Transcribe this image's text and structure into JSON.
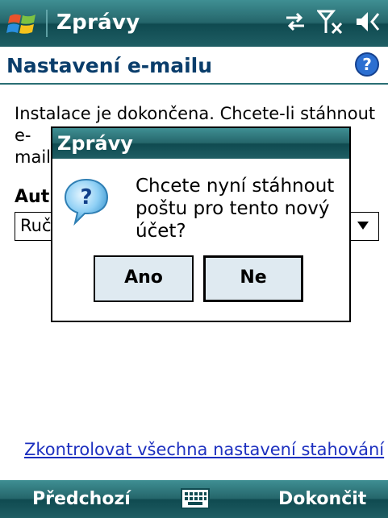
{
  "taskbar": {
    "title": "Zprávy",
    "icons": [
      "windows-start-icon",
      "connectivity-icon",
      "signal-off-icon",
      "volume-off-icon"
    ]
  },
  "header": {
    "title": "Nastavení e-mailu",
    "help_icon": "help-icon"
  },
  "content": {
    "body_line1": "Instalace je dokončena. Chcete-li stáhnout e-",
    "body_line2": "mail",
    "section_label": "Aut",
    "dropdown_value": "Ruč",
    "link_text": "Zkontrolovat všechna nastavení stahování"
  },
  "dialog": {
    "title": "Zprávy",
    "icon": "question-icon",
    "message": "Chcete nyní stáhnout poštu pro tento nový účet?",
    "yes_label": "Ano",
    "no_label": "Ne"
  },
  "softkeys": {
    "left": "Předchozí",
    "right": "Dokončit",
    "center_icon": "keyboard-icon"
  },
  "colors": {
    "bar": "#25666b",
    "title": "#0a3d6b",
    "link": "#1c2fbf",
    "button_bg": "#dfeaf1"
  }
}
